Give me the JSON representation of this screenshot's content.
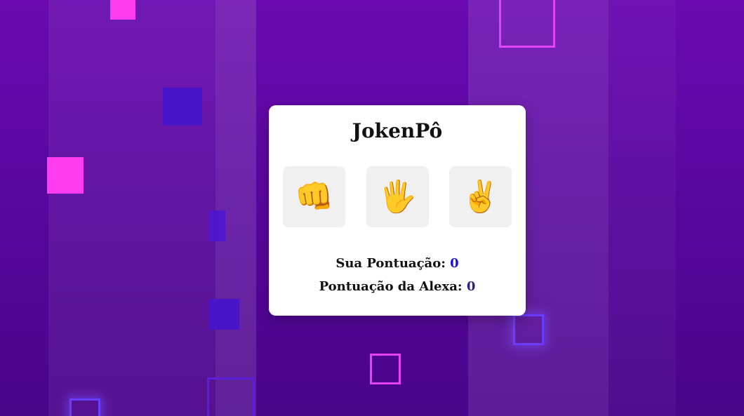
{
  "game": {
    "title": "JokenPô",
    "choices": [
      {
        "name": "rock",
        "symbol": "👊"
      },
      {
        "name": "paper",
        "symbol": "🖐"
      },
      {
        "name": "scissors",
        "symbol": "✌️"
      }
    ],
    "player_label": "Sua Pontuação:",
    "player_score": "0",
    "alexa_label": "Pontuação da Alexa:",
    "alexa_score": "0"
  },
  "colors": {
    "background_top": "#6a0ab0",
    "background_bottom": "#4b048a",
    "accent_pink": "#ff3cf0",
    "accent_blue": "#4a14c8",
    "player_score_color": "#1a10d8"
  }
}
